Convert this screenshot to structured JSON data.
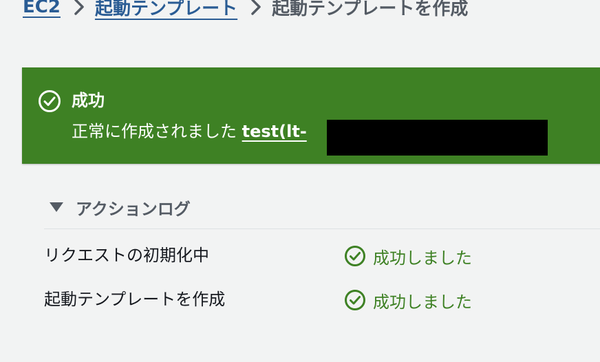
{
  "breadcrumb": {
    "items": [
      {
        "label": "EC2"
      },
      {
        "label": "起動テンプレート"
      },
      {
        "label": "起動テンプレートを作成"
      }
    ]
  },
  "flash": {
    "header": "成功",
    "message_prefix": "正常に作成されました ",
    "link_text": "test(lt-",
    "icon": "check-circle-icon",
    "color": "#3e8124"
  },
  "action_log": {
    "title": "アクションログ",
    "expanded": true,
    "rows": [
      {
        "label": "リクエストの初期化中",
        "status": "成功しました",
        "icon": "check-circle-icon"
      },
      {
        "label": "起動テンプレートを作成",
        "status": "成功しました",
        "icon": "check-circle-icon"
      }
    ]
  },
  "colors": {
    "link": "#2a5c94",
    "success": "#3e8124",
    "background": "#f2f3f3",
    "text": "#16191f",
    "muted": "#545b64"
  }
}
